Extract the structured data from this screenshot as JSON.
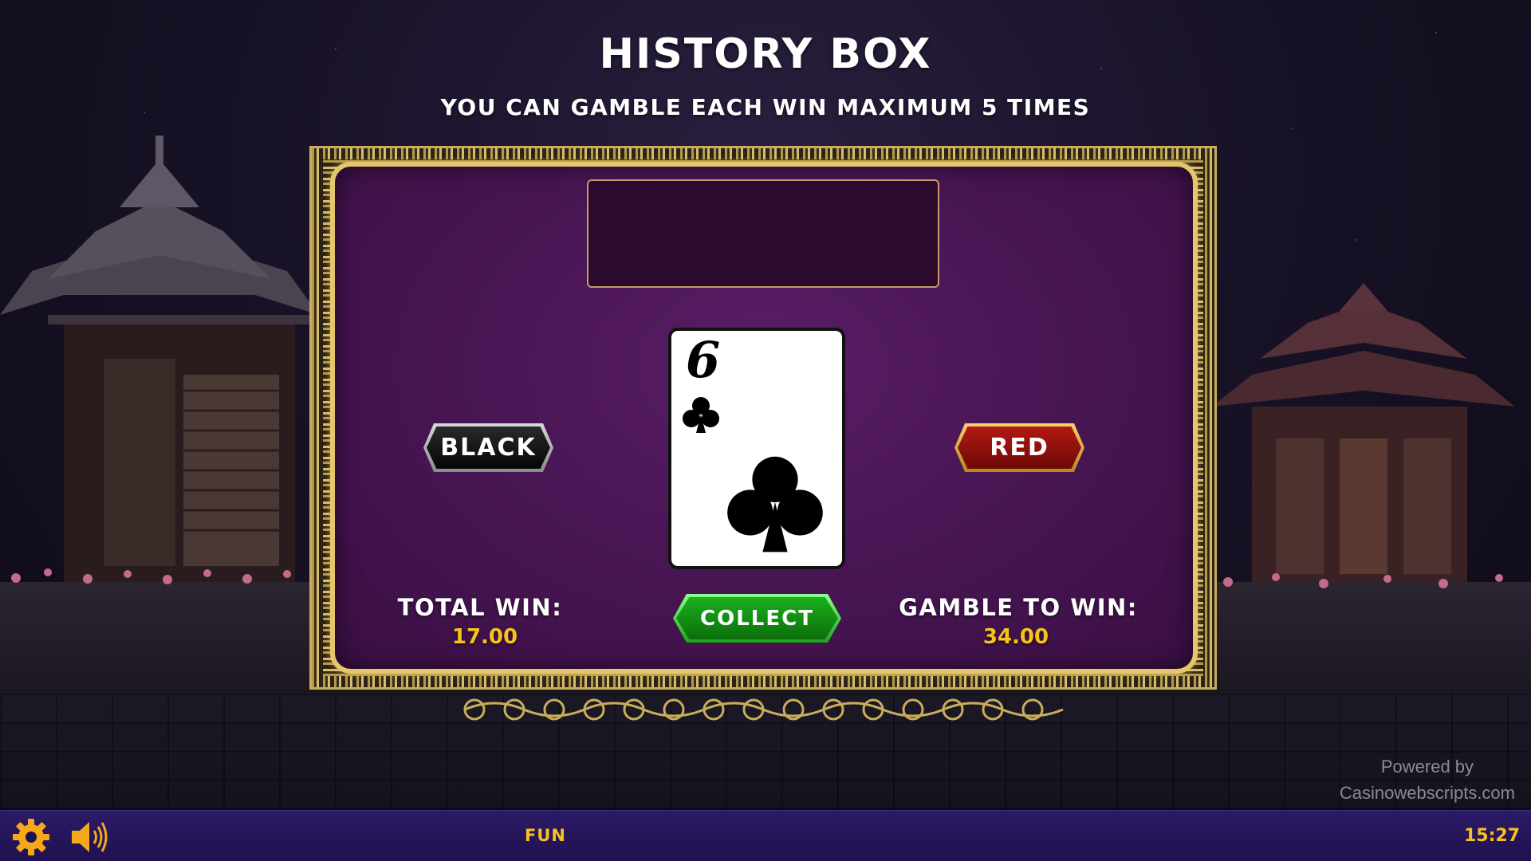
{
  "header": {
    "title": "HISTORY BOX",
    "subtitle": "YOU CAN GAMBLE EACH WIN MAXIMUM 5 TIMES"
  },
  "history": {
    "cards": []
  },
  "card": {
    "rank": "6",
    "suit": "clubs",
    "suit_icon": "club-icon",
    "suit_color": "#000000"
  },
  "buttons": {
    "black": "BLACK",
    "red": "RED",
    "collect": "COLLECT"
  },
  "total_win": {
    "label": "TOTAL WIN:",
    "value": "17.00"
  },
  "gamble_to_win": {
    "label": "GAMBLE TO WIN:",
    "value": "34.00"
  },
  "footer": {
    "powered_by_line1": "Powered by",
    "powered_by_line2": "Casinowebscripts.com"
  },
  "bottom_bar": {
    "mode": "FUN",
    "clock": "15:27",
    "settings_icon": "gear-icon",
    "sound_icon": "speaker-icon"
  },
  "colors": {
    "gold": "#f6c21b",
    "board_purple": "#4a1655",
    "frame_gold": "#e6c66b",
    "bar_purple": "#2c1a66",
    "collect_green": "#1cb01c",
    "red_button": "#b21a12"
  }
}
